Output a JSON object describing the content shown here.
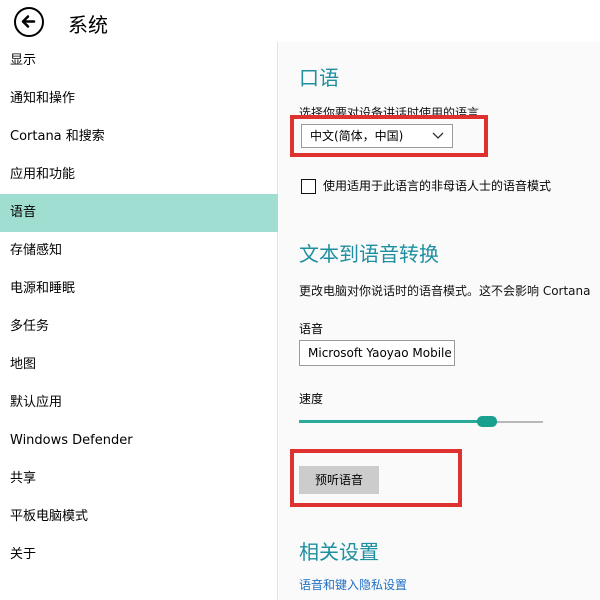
{
  "header": {
    "title": "系统",
    "back_icon": "back-arrow-icon"
  },
  "sidebar": {
    "active_index": 4,
    "items": [
      {
        "label": "显示"
      },
      {
        "label": "通知和操作"
      },
      {
        "label": "Cortana 和搜索"
      },
      {
        "label": "应用和功能"
      },
      {
        "label": "语音"
      },
      {
        "label": "存储感知"
      },
      {
        "label": "电源和睡眠"
      },
      {
        "label": "多任务"
      },
      {
        "label": "地图"
      },
      {
        "label": "默认应用"
      },
      {
        "label": "Windows Defender"
      },
      {
        "label": "共享"
      },
      {
        "label": "平板电脑模式"
      },
      {
        "label": "关于"
      }
    ],
    "active_color": "#9fded0"
  },
  "speech": {
    "title": "口语",
    "prompt": "选择你要对设备讲话时使用的语言",
    "language_value": "中文(简体，中国)",
    "nonnative_label": "使用适用于此语言的非母语人士的语音模式",
    "nonnative_checked": false
  },
  "tts": {
    "title": "文本到语音转换",
    "desc": "更改电脑对你说话时的语音模式。这不会影响 Cortana",
    "voice_label": "语音",
    "voice_value": "Microsoft Yaoyao Mobile",
    "speed_label": "速度",
    "speed_fraction": 0.77,
    "preview_label": "预听语音"
  },
  "related": {
    "title": "相关设置",
    "link": "语音和键入隐私设置"
  },
  "colors": {
    "accent": "#1f8fa0",
    "link": "#1f6fc4",
    "slider": "#18a08f",
    "highlight": "#e03131"
  }
}
